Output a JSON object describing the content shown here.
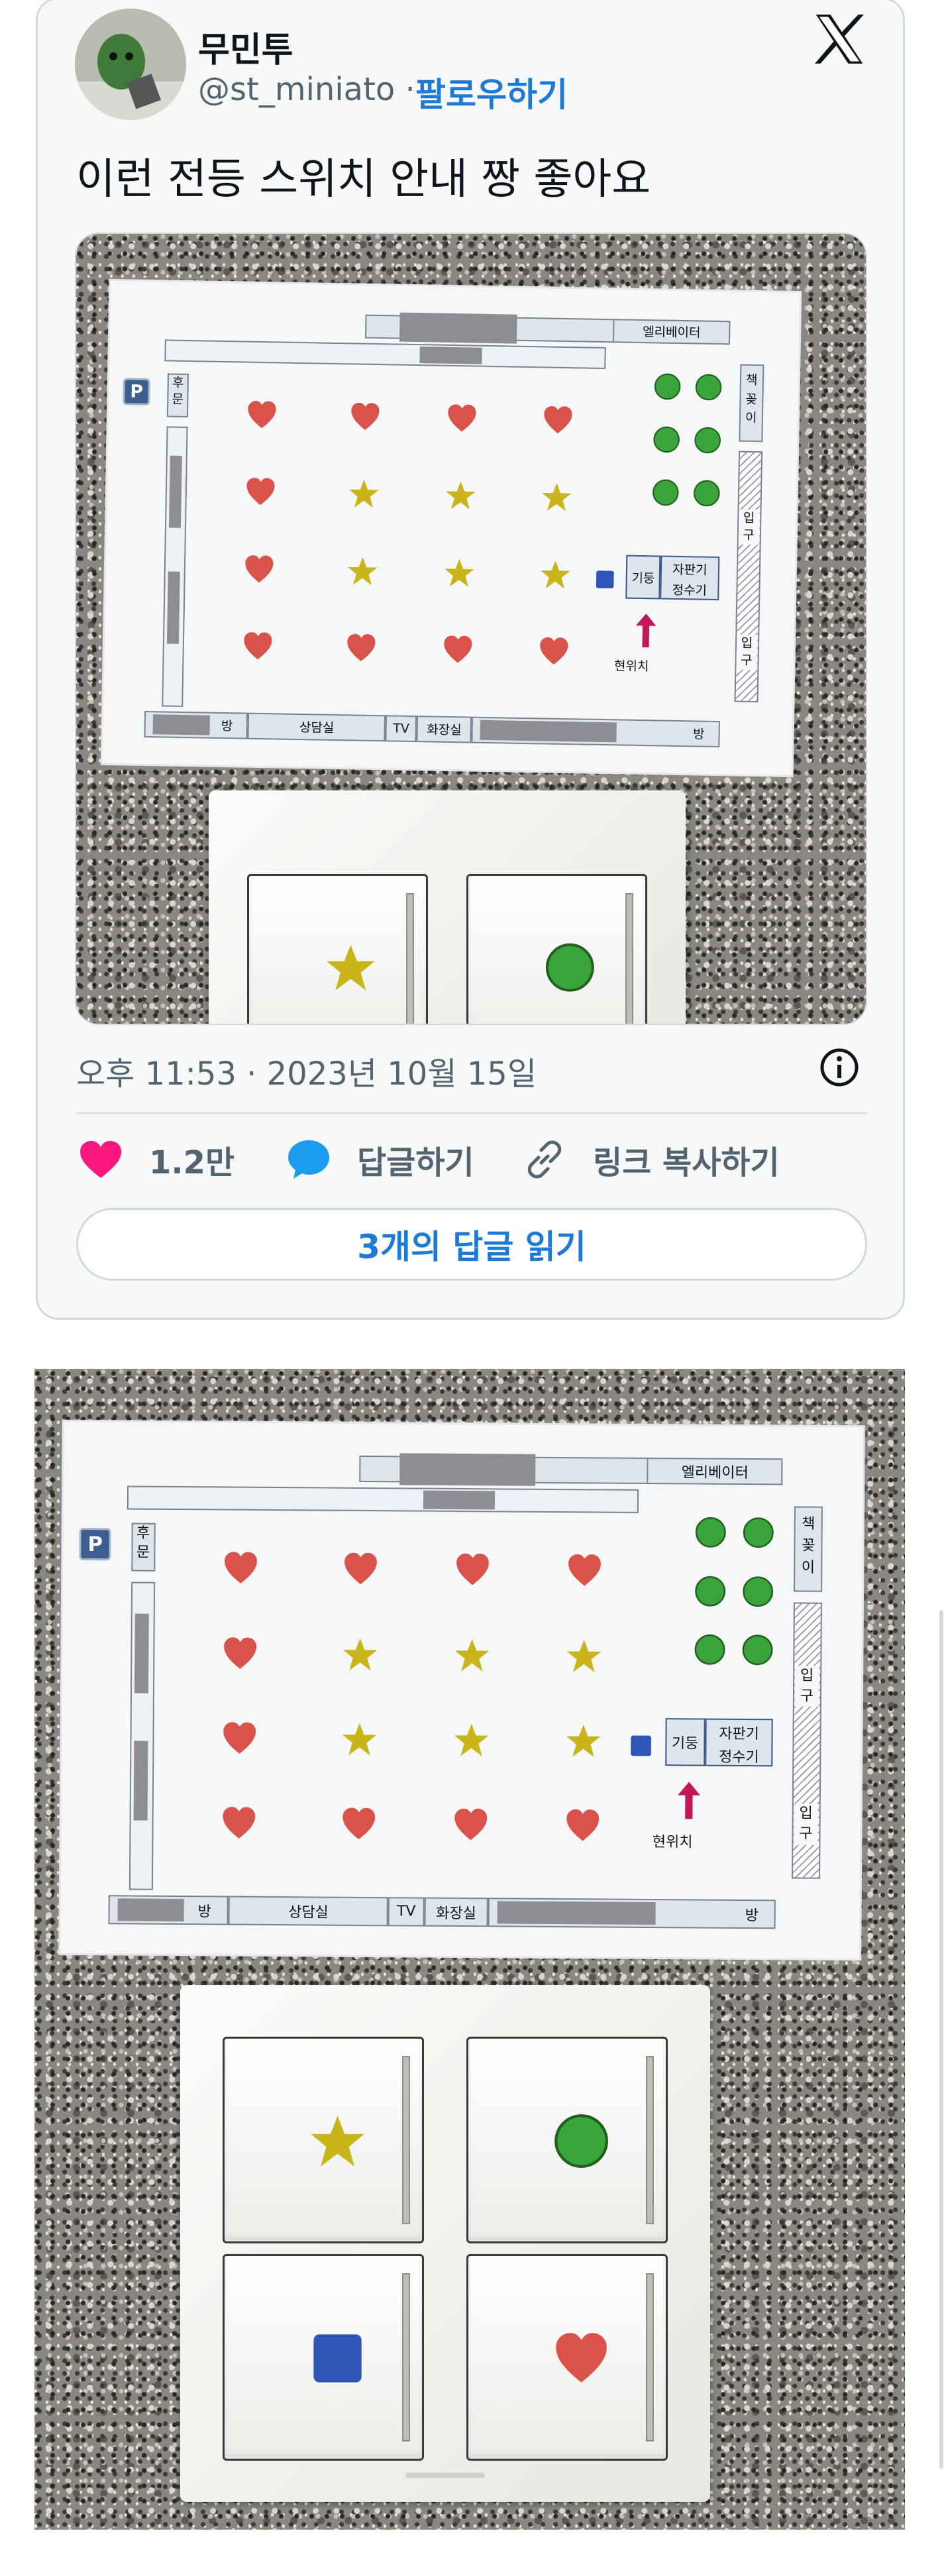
{
  "tweet": {
    "author_name": "무민투",
    "handle": "@st_miniato",
    "separator": "·",
    "follow_label": "팔로우하기",
    "text": "이런 전등 스위치 안내 짱 좋아요",
    "timestamp": "오후 11:53 · 2023년 10월 15일",
    "actions": {
      "like_count": "1.2만",
      "reply_label": "답글하기",
      "copy_link_label": "링크 복사하기"
    },
    "read_replies_label": "3개의 답글 읽기"
  },
  "floor_plan": {
    "elevator": "엘리베이터",
    "bookshelf": "책꽂이",
    "back_door": "후문",
    "parking": "P",
    "entrance": "입구",
    "pillar": "기둥",
    "vending": "자판기",
    "water": "정수기",
    "current_location": "현위치",
    "room_suffix": "방",
    "counseling": "상담실",
    "tv": "TV",
    "restroom": "화장실"
  },
  "switch_symbols": [
    "star",
    "circle",
    "square",
    "heart"
  ],
  "colors": {
    "link_blue": "#1d7bd7",
    "like_pink": "#f91880",
    "heart_red": "#d9534a",
    "star_yellow": "#c9b41a",
    "circle_green": "#3aa33a",
    "square_blue": "#2d56b8"
  },
  "icons": {
    "brand": "x-logo-icon",
    "info": "info-icon",
    "like": "heart-icon",
    "reply": "reply-bubble-icon",
    "link": "link-icon"
  }
}
